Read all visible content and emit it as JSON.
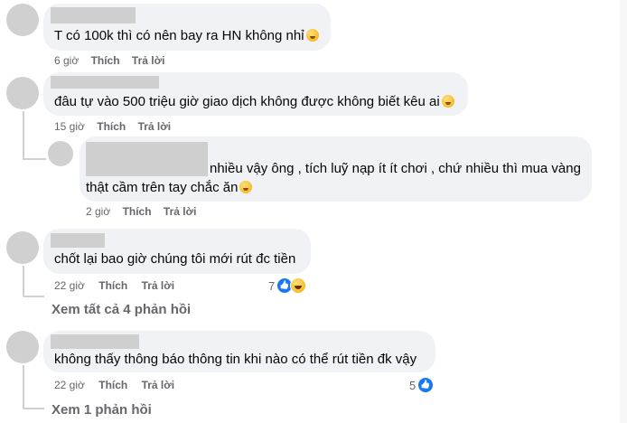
{
  "comments": [
    {
      "text": "T có 100k thì có nên bay ra HN không nhỉ",
      "time": "6 giờ",
      "like": "Thích",
      "reply": "Trả lời"
    },
    {
      "text": "đâu tự vào 500 triệu giờ giao dịch không được không biết kêu ai",
      "time": "15 giờ",
      "like": "Thích",
      "reply": "Trả lời"
    },
    {
      "text_line1": "nhiều vậy ông , tích luỹ nạp ít ít chơi , chứ nhiều thì mua vàng",
      "text_line2": "thật cầm trên tay chắc ăn",
      "time": "2 giờ",
      "like": "Thích",
      "reply": "Trả lời"
    },
    {
      "text": "chốt lại bao giờ chúng tôi mới rút đc tiền",
      "time": "22 giờ",
      "like": "Thích",
      "reply": "Trả lời",
      "reaction_count": "7",
      "reactions": [
        "like-icon",
        "haha-icon"
      ]
    },
    {
      "text": "không thấy thông báo thông tin khi nào có thể rút tiền đk vậy",
      "time": "22 giờ",
      "like": "Thích",
      "reply": "Trả lời",
      "reaction_count": "5",
      "reactions": [
        "like-icon"
      ]
    }
  ],
  "view_more_1": "Xem tất cả 4 phản hồi",
  "view_more_2": "Xem 1 phản hồi",
  "colors": {
    "bubble": "#f0f2f5",
    "meta": "#65676b",
    "like_blue": "#1877f2"
  }
}
